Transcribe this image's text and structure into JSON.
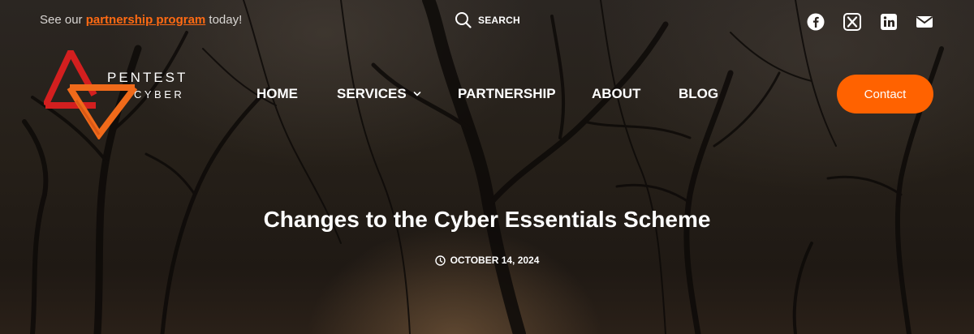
{
  "topbar": {
    "promo_prefix": "See our",
    "promo_link": "partnership program",
    "promo_suffix": "today!",
    "search_label": "SEARCH",
    "social": [
      "facebook-icon",
      "x-icon",
      "linkedin-icon",
      "mail-icon"
    ]
  },
  "logo": {
    "line1": "PENTEST",
    "line2": "CYBER",
    "colors": {
      "red": "#d31f1f",
      "orange": "#f06a1a"
    }
  },
  "nav": {
    "items": [
      {
        "label": "HOME"
      },
      {
        "label": "SERVICES",
        "has_dropdown": true
      },
      {
        "label": "PARTNERSHIP"
      },
      {
        "label": "ABOUT"
      },
      {
        "label": "BLOG"
      }
    ],
    "contact_label": "Contact"
  },
  "post": {
    "title": "Changes to the Cyber Essentials Scheme",
    "date": "OCTOBER 14, 2024"
  },
  "colors": {
    "accent": "#ff6200",
    "link": "#ff6a13",
    "text": "#ffffff"
  }
}
